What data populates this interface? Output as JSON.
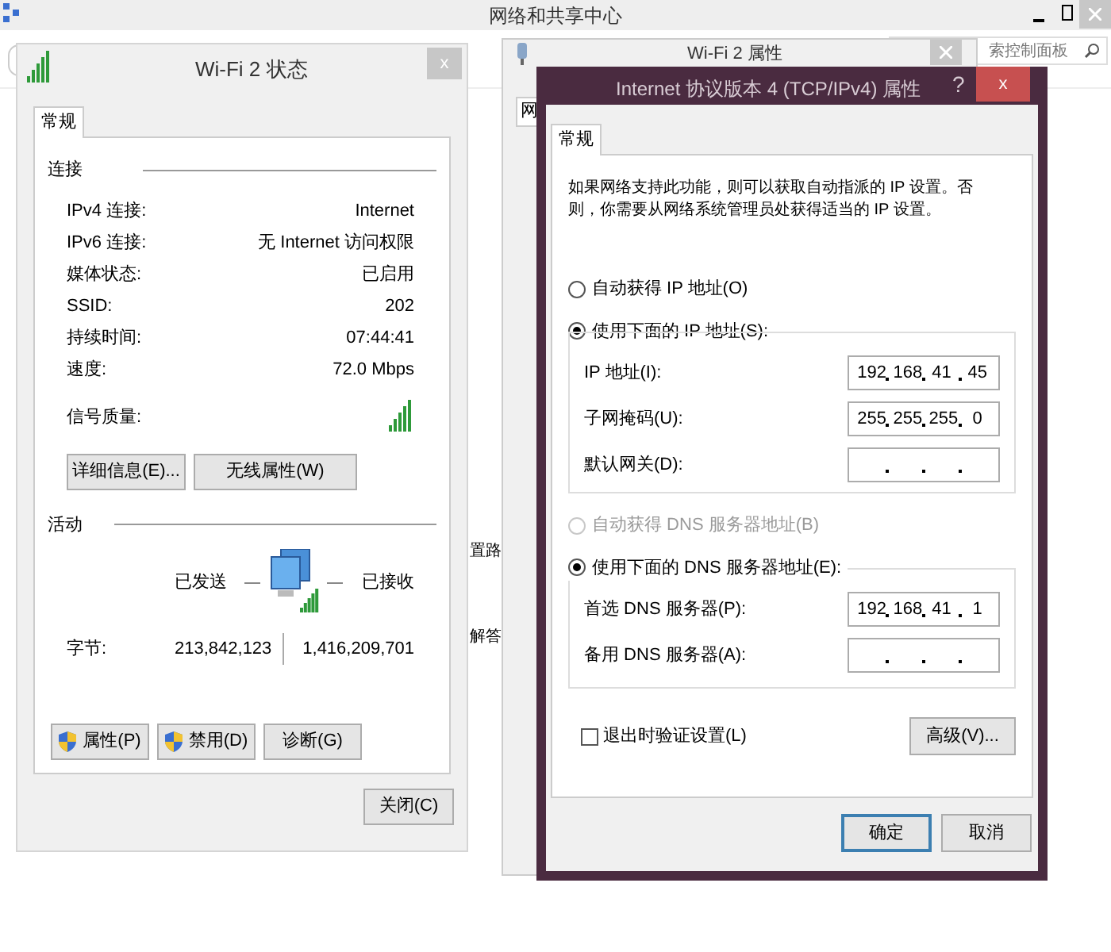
{
  "background_window": {
    "title": "网络和共享中心",
    "search_placeholder": "索控制面板",
    "fragments": [
      "置路",
      "解答"
    ]
  },
  "properties_window": {
    "title": "Wi-Fi 2 属性",
    "tab_fragment": "网"
  },
  "status_dialog": {
    "title": "Wi-Fi 2 状态",
    "close": "x",
    "tabs": [
      {
        "label": "常规",
        "selected": true
      }
    ],
    "connection": {
      "heading": "连接",
      "rows": [
        {
          "label": "IPv4 连接:",
          "value": "Internet"
        },
        {
          "label": "IPv6 连接:",
          "value": "无 Internet 访问权限"
        },
        {
          "label": "媒体状态:",
          "value": "已启用"
        },
        {
          "label": "SSID:",
          "value": "202"
        },
        {
          "label": "持续时间:",
          "value": "07:44:41"
        },
        {
          "label": "速度:",
          "value": "72.0 Mbps"
        }
      ],
      "signal_label": "信号质量:",
      "buttons": [
        "详细信息(E)...",
        "无线属性(W)"
      ]
    },
    "activity": {
      "heading": "活动",
      "sent": "已发送",
      "received": "已接收",
      "bytes_label": "字节:",
      "bytes_sent": "213,842,123",
      "bytes_received": "1,416,209,701"
    },
    "actions": [
      {
        "label": "属性(P)",
        "shield": true
      },
      {
        "label": "禁用(D)",
        "shield": true
      },
      {
        "label": "诊断(G)",
        "shield": false
      }
    ],
    "close_button": "关闭(C)"
  },
  "ipv4_dialog": {
    "title": "Internet 协议版本 4 (TCP/IPv4) 属性",
    "help": "?",
    "close": "x",
    "tabs": [
      {
        "label": "常规",
        "selected": true
      }
    ],
    "description": "如果网络支持此功能，则可以获取自动指派的 IP 设置。否则，你需要从网络系统管理员处获得适当的 IP 设置。",
    "ip_options": [
      {
        "label": "自动获得 IP 地址(O)",
        "selected": false
      },
      {
        "label": "使用下面的 IP 地址(S):",
        "selected": true
      }
    ],
    "ip_fields": [
      {
        "label": "IP 地址(I):",
        "octets": [
          "192",
          "168",
          "41",
          "45"
        ]
      },
      {
        "label": "子网掩码(U):",
        "octets": [
          "255",
          "255",
          "255",
          "0"
        ]
      },
      {
        "label": "默认网关(D):"
      }
    ],
    "dns_options": [
      {
        "label": "自动获得 DNS 服务器地址(B)",
        "selected": false,
        "disabled": true
      },
      {
        "label": "使用下面的 DNS 服务器地址(E):",
        "selected": true,
        "disabled": false
      }
    ],
    "dns_fields": [
      {
        "label": "首选 DNS 服务器(P):",
        "octets": [
          "192",
          "168",
          "41",
          "1"
        ]
      },
      {
        "label": "备用 DNS 服务器(A):"
      }
    ],
    "validate": {
      "label": "退出时验证设置(L)",
      "checked": false
    },
    "advanced": "高级(V)...",
    "ok": "确定",
    "cancel": "取消"
  }
}
